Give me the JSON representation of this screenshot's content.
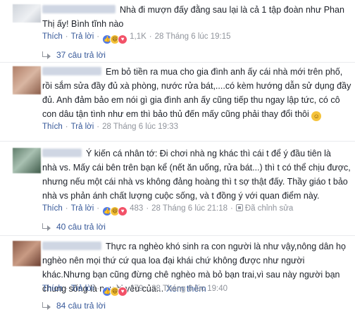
{
  "comments": [
    {
      "lines": [
        "Nhà đi mượn đấy đằng sau lại là cả 1 tập đoàn như Phan",
        "Thị ấy! Bình tĩnh nào"
      ],
      "like": "Thích",
      "reply": "Trả lời",
      "reactions": "1,1K",
      "time": "28 Tháng 6 lúc 19:15",
      "replies": "37 câu trả lời"
    },
    {
      "lines": [
        "Em bỏ tiền ra mua cho gia đình anh ấy cái nhà mới trên phố,",
        "rồi sắm sửa đầy đủ xà phòng, nước rửa bát,....có kèm hướng dẫn sử dụng đầy",
        "đủ. Anh đảm bảo em nói gì gia đình anh ấy cũng tiếp thu ngay lập tức, có cô",
        "con dâu tận tình như em thì bảo thủ đến mấy cũng phải thay đổi thôi"
      ],
      "like": "Thích",
      "reply": "Trả lời",
      "time": "28 Tháng 6 lúc 19:33"
    },
    {
      "lines": [
        "Ý kiến cá nhân tớ: Đi chơi nhà ng khác thì cái t để ý đầu tiên là",
        "nhà vs. Mấy cái bên trên bạn kể (nết ăn uống, rửa bát...) thì t có thể chịu được,",
        "nhưng nếu một cái nhà vs không đảng hoàng thì t sợ thật đấy. Thầy giáo t bảo",
        "nhà vs phản ánh chất lượng cuộc sống, và t đồng ý với quan điểm này."
      ],
      "like": "Thích",
      "reply": "Trả lời",
      "reactions": "483",
      "time": "28 Tháng 6 lúc 21:18",
      "edited": "Đã chỉnh sửa",
      "replies": "40 câu trả lời"
    },
    {
      "lines": [
        "Thực ra nghèo khó sinh ra con người là như vậy,nông dân họ",
        "nghèo nên mọi thứ cứ qua loa đại khái chứ không được như người",
        "khác.Nhưng bạn cũng đừng chê nghèo mà bỏ bạn trai,vì sau này người bạn",
        "chung sống là người yêu của..."
      ],
      "see_more": "Xem thêm",
      "like": "Thích",
      "reply": "Trả lời",
      "reactions": "479",
      "time": "28 Tháng 6 lúc 19:40",
      "replies": "84 câu trả lời"
    }
  ],
  "icons": {
    "react_like": "like-icon",
    "react_haha": "haha-icon",
    "react_love": "love-icon",
    "reply_arrow": "reply-arrow-icon",
    "smiley": "smiley-emoji-icon"
  },
  "colors": {
    "link": "#365899",
    "meta": "#90949c",
    "text": "#1d2129",
    "like": "#4f7ae8",
    "love": "#f25268",
    "haha": "#f5c33b"
  }
}
